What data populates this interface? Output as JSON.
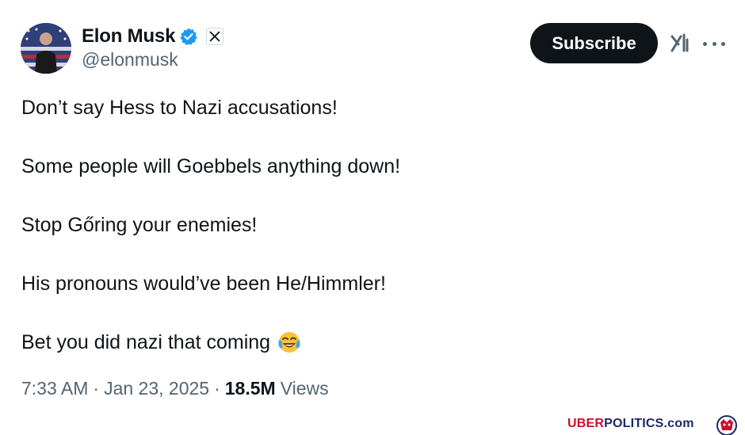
{
  "author": {
    "display_name": "Elon Musk",
    "handle": "@elonmusk",
    "verified_icon": "verified-badge-icon",
    "affiliate_icon": "x-logo-icon",
    "avatar": "avatar"
  },
  "actions": {
    "subscribe_label": "Subscribe",
    "grok_icon": "grok-icon",
    "more_icon": "more-dots-icon"
  },
  "post": {
    "lines": [
      "Don’t say Hess to Nazi accusations!",
      "Some people will Goebbels anything down!",
      "Stop Gőring your enemies!",
      "His pronouns would’ve been He/Himmler!",
      "Bet you did nazi that coming"
    ],
    "emoji": "face-with-tears-of-joy-icon"
  },
  "meta": {
    "time": "7:33 AM",
    "date": "Jan 23, 2025",
    "separator": "·",
    "views_count": "18.5M",
    "views_label": "Views"
  },
  "watermark": {
    "part1": "UBER",
    "part2": "POLITICS.com"
  },
  "colors": {
    "text": "#0f1419",
    "secondary": "#536471",
    "verified": "#1d9bf0",
    "button_bg": "#0f1419",
    "watermark_red": "#c8102e",
    "watermark_blue": "#1a2a6c"
  }
}
